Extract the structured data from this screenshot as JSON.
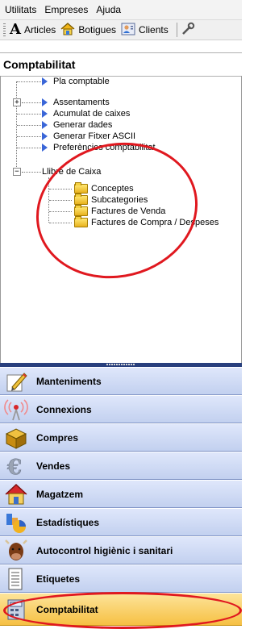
{
  "menu": [
    "Utilitats",
    "Empreses",
    "Ajuda"
  ],
  "toolbar": {
    "buttons": [
      {
        "label": "Articles",
        "icon": "letter-a-icon"
      },
      {
        "label": "Botigues",
        "icon": "house-icon"
      },
      {
        "label": "Clients",
        "icon": "person-card-icon"
      }
    ]
  },
  "panel_title": "Comptabilitat",
  "tree": {
    "items": [
      {
        "label": "Pla comptable"
      },
      {
        "label": "Assentaments",
        "expander": "+"
      },
      {
        "label": "Acumulat de caixes"
      },
      {
        "label": "Generar dades"
      },
      {
        "label": "Generar Fitxer ASCII"
      },
      {
        "label": "Preferències comptabilitat"
      },
      {
        "label": "Llibre de Caixa",
        "expander": "−"
      }
    ],
    "children": [
      {
        "label": "Conceptes"
      },
      {
        "label": "Subcategories"
      },
      {
        "label": "Factures de Venda"
      },
      {
        "label": "Factures de Compra / Despeses"
      }
    ]
  },
  "nav": [
    {
      "label": "Manteniments",
      "icon": "pencil-icon"
    },
    {
      "label": "Connexions",
      "icon": "antenna-icon"
    },
    {
      "label": "Compres",
      "icon": "box-icon"
    },
    {
      "label": "Vendes",
      "icon": "euro-icon"
    },
    {
      "label": "Magatzem",
      "icon": "warehouse-icon"
    },
    {
      "label": "Estadístiques",
      "icon": "chart-icon"
    },
    {
      "label": "Autocontrol higiènic i sanitari",
      "icon": "cow-icon"
    },
    {
      "label": "Etiquetes",
      "icon": "label-printer-icon"
    },
    {
      "label": "Comptabilitat",
      "icon": "calculator-icon",
      "selected": true
    }
  ],
  "colors": {
    "selected_nav": "#f6c043",
    "nav": "#c2d0ef",
    "annotation": "#e0181f"
  }
}
